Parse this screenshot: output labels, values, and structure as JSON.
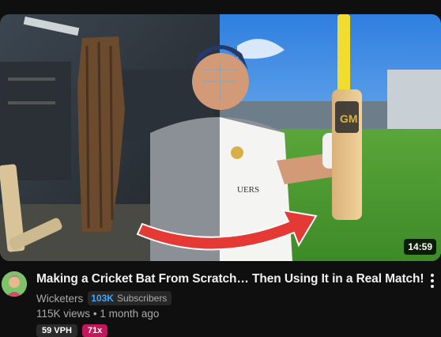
{
  "video": {
    "title": "Making a Cricket Bat From Scratch… Then Using It in a Real Match!",
    "duration": "14:59",
    "channel": "Wicketers",
    "subscriber_count": "103K",
    "subscriber_label": "Subscribers",
    "views": "115K views",
    "separator": "•",
    "age": "1 month ago",
    "stat_badges": [
      "59 VPH",
      "71x"
    ]
  },
  "thumbnail": {
    "bat_logo_text": "GM",
    "shirt_text": "UERS"
  },
  "colors": {
    "background": "#0f0f0f",
    "subscriber_accent": "#3ea6ff",
    "arrow_red": "#e53935",
    "multiplier_badge": "#c2185b"
  },
  "icons": [
    "more-vert-icon",
    "channel-avatar"
  ]
}
